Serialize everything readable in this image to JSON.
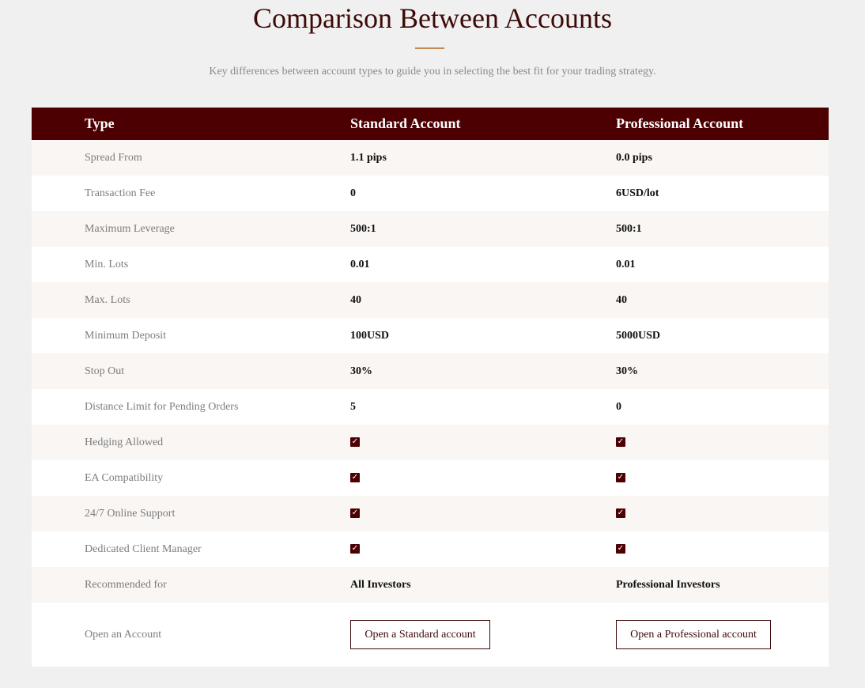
{
  "header": {
    "title": "Comparison Between Accounts",
    "subtitle": "Key differences between account types to guide you in selecting the best fit for your trading strategy."
  },
  "table": {
    "columns": [
      "Type",
      "Standard Account",
      "Professional Account"
    ],
    "rows": [
      {
        "label": "Spread From",
        "standard": "1.1 pips",
        "professional": "0.0 pips"
      },
      {
        "label": "Transaction Fee",
        "standard": "0",
        "professional": "6USD/lot"
      },
      {
        "label": "Maximum Leverage",
        "standard": "500:1",
        "professional": "500:1"
      },
      {
        "label": "Min. Lots",
        "standard": "0.01",
        "professional": "0.01"
      },
      {
        "label": "Max. Lots",
        "standard": "40",
        "professional": "40"
      },
      {
        "label": "Minimum Deposit",
        "standard": "100USD",
        "professional": "5000USD"
      },
      {
        "label": "Stop Out",
        "standard": "30%",
        "professional": "30%"
      },
      {
        "label": "Distance Limit for Pending Orders",
        "standard": "5",
        "professional": "0"
      },
      {
        "label": "Hedging Allowed",
        "standard": "check-icon",
        "professional": "check-icon"
      },
      {
        "label": "EA Compatibility",
        "standard": "check-icon",
        "professional": "check-icon"
      },
      {
        "label": "24/7 Online Support",
        "standard": "check-icon",
        "professional": "check-icon"
      },
      {
        "label": "Dedicated Client Manager",
        "standard": "check-icon",
        "professional": "check-icon"
      },
      {
        "label": "Recommended for",
        "standard": "All Investors",
        "professional": "Professional Investors"
      }
    ],
    "open_row": {
      "label": "Open an Account",
      "standard_button": "Open a Standard account",
      "professional_button": "Open a Professional account"
    }
  },
  "colors": {
    "header_bg": "#4d0002",
    "accent_rule": "#c08a52",
    "title": "#3d0a08",
    "row_alt": "#f9f6f3",
    "page_bg": "#f0f0f0"
  }
}
